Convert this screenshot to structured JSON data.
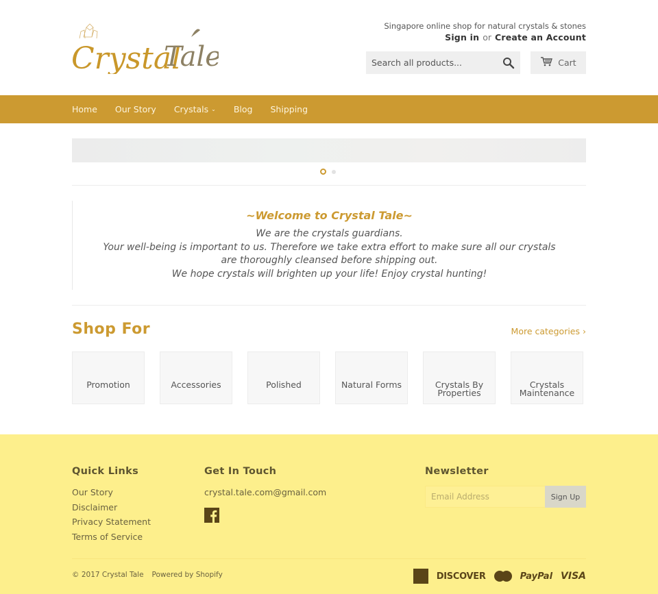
{
  "header": {
    "logo_text_1": "Crystal",
    "logo_text_2": "Tale",
    "tagline": "Singapore online shop for natural crystals & stones",
    "sign_in": "Sign in",
    "or": "or",
    "create_account": "Create an Account",
    "search_placeholder": "Search all products...",
    "search_icon": "search-icon",
    "cart_label": "Cart",
    "cart_icon": "cart-icon"
  },
  "nav": {
    "items": [
      {
        "label": "Home"
      },
      {
        "label": "Our Story"
      },
      {
        "label": "Crystals",
        "has_dropdown": true
      },
      {
        "label": "Blog"
      },
      {
        "label": "Shipping"
      }
    ]
  },
  "slider": {
    "slide_count": 2,
    "active_slide": 1
  },
  "welcome": {
    "title": "~Welcome to Crystal Tale~",
    "lines": [
      "We are the crystals guardians.",
      "Your well-being is important to us. Therefore we take extra effort to make sure all our crystals are thoroughly cleansed before shipping out.",
      "We hope crystals will brighten up your life! Enjoy crystal hunting!"
    ]
  },
  "shop": {
    "title": "Shop For",
    "more_link": "More categories ›",
    "categories": [
      {
        "line1": "Promotion",
        "line2": ""
      },
      {
        "line1": "Accessories",
        "line2": ""
      },
      {
        "line1": "Polished",
        "line2": ""
      },
      {
        "line1": "Natural Forms",
        "line2": ""
      },
      {
        "line1": "Crystals By",
        "line2": "Properties"
      },
      {
        "line1": "Crystals",
        "line2": "Maintenance"
      }
    ]
  },
  "footer": {
    "quick_links": {
      "title": "Quick Links",
      "items": [
        "Our Story",
        "Disclaimer",
        "Privacy Statement",
        "Terms of Service"
      ]
    },
    "get_in_touch": {
      "title": "Get In Touch",
      "email": "crystal.tale.com@gmail.com",
      "social_icon": "facebook-icon"
    },
    "newsletter": {
      "title": "Newsletter",
      "placeholder": "Email Address",
      "button": "Sign Up"
    },
    "copyright": "© 2017 Crystal Tale",
    "powered_by": "Powered by Shopify",
    "payments": [
      "American Express",
      "DISCOVER",
      "MasterCard",
      "PayPal",
      "VISA"
    ]
  },
  "colors": {
    "brand_gold": "#cc9a31",
    "footer_bg": "#fdef8c",
    "footer_text": "#5e5530",
    "payment_icon": "#5a4518"
  }
}
